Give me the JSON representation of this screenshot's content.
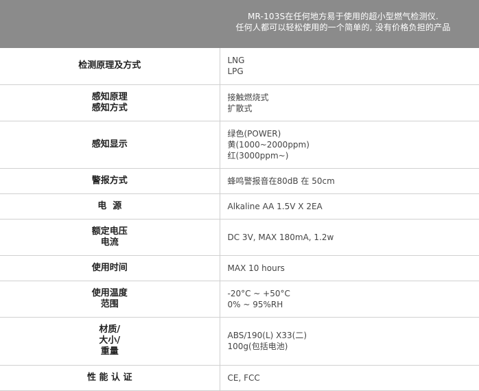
{
  "header": {
    "intro_line1": "MR-103S在任何地方易于使用的超小型燃气检测仪.",
    "intro_line2": "任何人都可以轻松使用的一个简单的, 没有价格负担的产品"
  },
  "specs": [
    {
      "label": [
        "检测原理及方式"
      ],
      "values": [
        "LNG",
        "LPG"
      ]
    },
    {
      "label": [
        "感知原理",
        "感知方式"
      ],
      "values": [
        "接触燃烧式",
        "扩散式"
      ]
    },
    {
      "label": [
        "感知显示"
      ],
      "values": [
        "绿色(POWER)",
        "黄(1000~2000ppm)",
        "红(3000ppm~)"
      ]
    },
    {
      "label": [
        "警报方式"
      ],
      "values": [
        "蜂鸣警报音在80dB 在 50cm"
      ]
    },
    {
      "label": [
        "电  源"
      ],
      "values": [
        "Alkaline AA 1.5V X 2EA"
      ]
    },
    {
      "label": [
        "额定电压",
        "电流"
      ],
      "values": [
        "DC 3V, MAX 180mA, 1.2w"
      ]
    },
    {
      "label": [
        "使用时间"
      ],
      "values": [
        "MAX 10 hours"
      ]
    },
    {
      "label": [
        "使用温度",
        "范围"
      ],
      "values": [
        "-20°C ~ +50°C",
        "0% ~ 95%RH"
      ]
    },
    {
      "label": [
        "材质/",
        "大小/",
        "重量"
      ],
      "values": [
        "ABS/190(L) X33(二)",
        "100g(包括电池)"
      ]
    },
    {
      "label": [
        "性 能 认 证"
      ],
      "values": [
        "CE, FCC"
      ]
    }
  ]
}
